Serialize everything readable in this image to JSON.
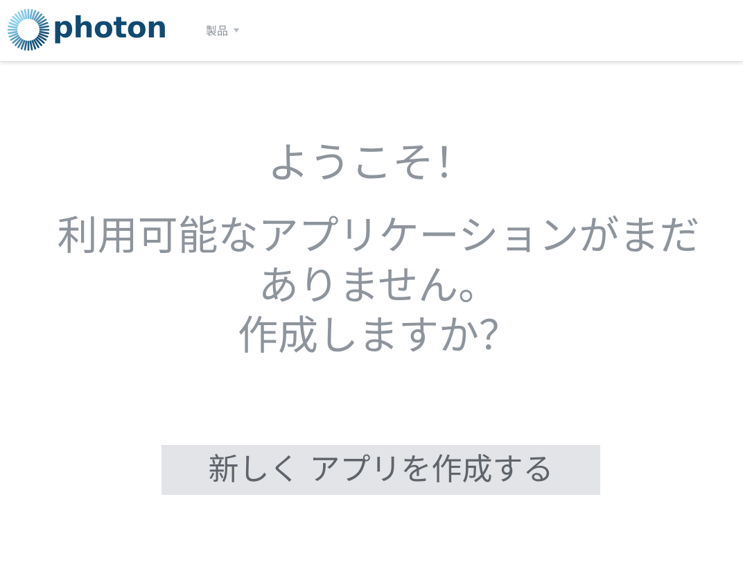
{
  "header": {
    "logo_text": "photon",
    "logo_icon": "photon-sunburst-icon",
    "nav": {
      "products_label": "製品",
      "products_icon": "caret-down-icon"
    }
  },
  "main": {
    "welcome": "ようこそ！",
    "message_line1": "利用可能なアプリケーションがまだありません。",
    "message_line2": "作成しますか？",
    "create_button_label": "新しく アプリを作成する"
  },
  "colors": {
    "brand": "#0f4a72",
    "text_muted": "#8e949c",
    "button_bg": "#e3e4e7",
    "button_text": "#5f646b"
  }
}
